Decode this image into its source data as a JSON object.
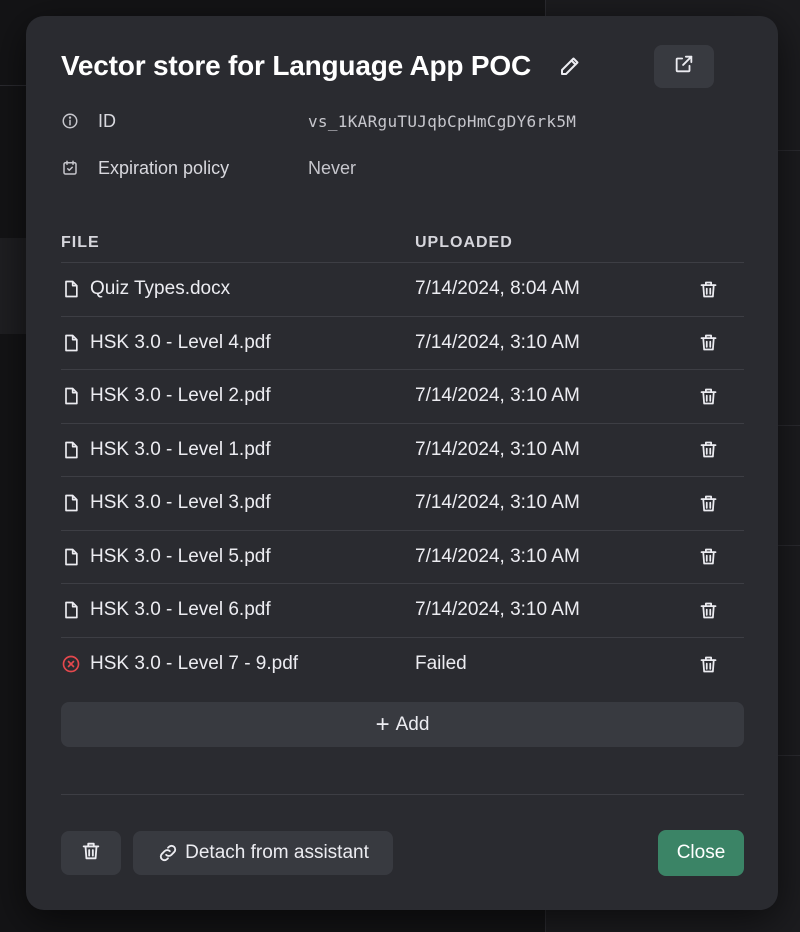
{
  "modal": {
    "title": "Vector store for Language App POC",
    "meta": [
      {
        "icon": "info-icon",
        "label": "ID",
        "value": "vs_1KARguTUJqbCpHmCgDY6rk5M"
      },
      {
        "icon": "calendar-check-icon",
        "label": "Expiration policy",
        "value": "Never"
      }
    ],
    "table": {
      "headers": {
        "file": "FILE",
        "uploaded": "UPLOADED"
      },
      "rows": [
        {
          "file": "Quiz Types.docx",
          "uploaded": "7/14/2024, 8:04 AM",
          "status": "ok"
        },
        {
          "file": "HSK 3.0 - Level 4.pdf",
          "uploaded": "7/14/2024, 3:10 AM",
          "status": "ok"
        },
        {
          "file": "HSK 3.0 - Level 2.pdf",
          "uploaded": "7/14/2024, 3:10 AM",
          "status": "ok"
        },
        {
          "file": "HSK 3.0 - Level 1.pdf",
          "uploaded": "7/14/2024, 3:10 AM",
          "status": "ok"
        },
        {
          "file": "HSK 3.0 - Level 3.pdf",
          "uploaded": "7/14/2024, 3:10 AM",
          "status": "ok"
        },
        {
          "file": "HSK 3.0 - Level 5.pdf",
          "uploaded": "7/14/2024, 3:10 AM",
          "status": "ok"
        },
        {
          "file": "HSK 3.0 - Level 6.pdf",
          "uploaded": "7/14/2024, 3:10 AM",
          "status": "ok"
        },
        {
          "file": "HSK 3.0 - Level 7 - 9.pdf",
          "uploaded": "Failed",
          "status": "failed"
        }
      ]
    },
    "add_label": "Add",
    "detach_label": "Detach from assistant",
    "close_label": "Close"
  },
  "colors": {
    "modal_bg": "#2a2b30",
    "button_bg": "#383a40",
    "primary": "#3b8466",
    "error": "#e5484d"
  }
}
